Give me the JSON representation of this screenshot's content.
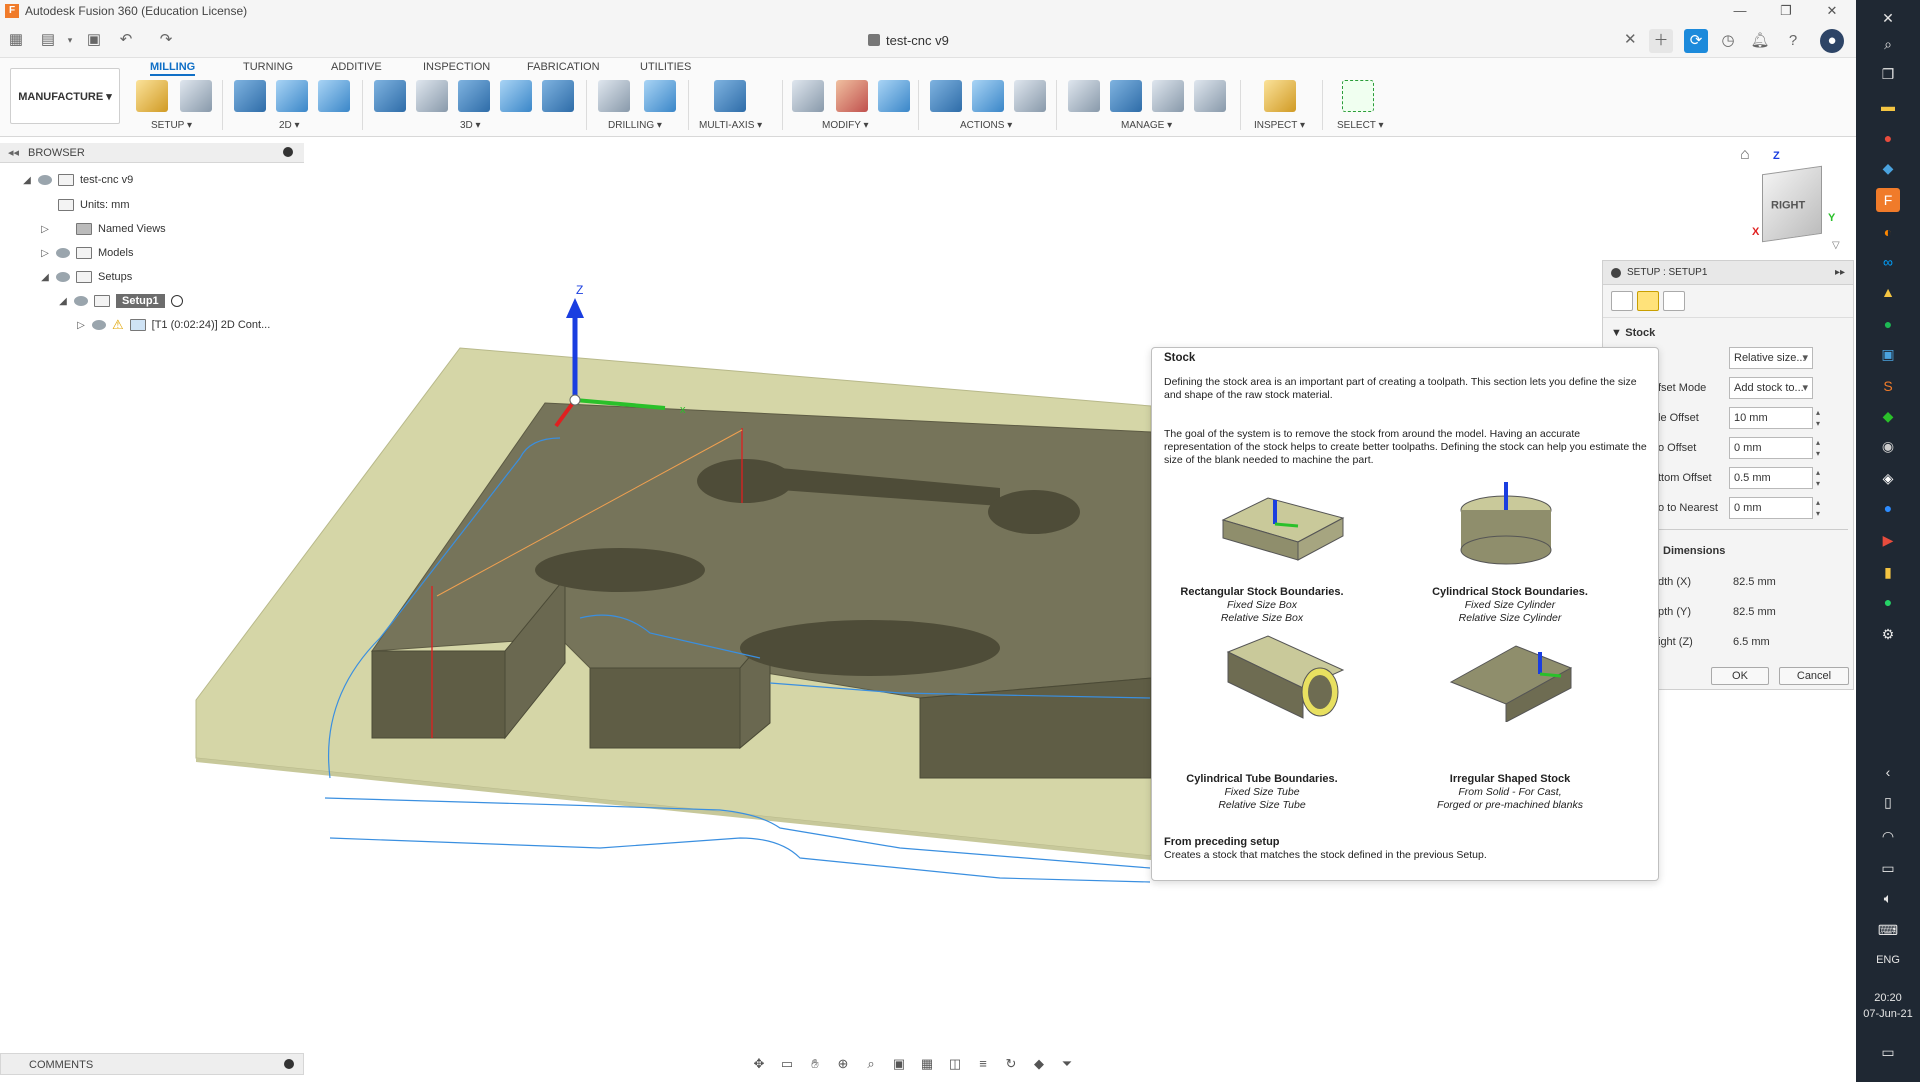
{
  "app": {
    "title": "Autodesk Fusion 360 (Education License)",
    "document_tab": "test-cnc v9",
    "accent": "#0f6fc6",
    "app_icon_letter": "F"
  },
  "ribbon": {
    "workspace": "MANUFACTURE",
    "tabs": [
      "MILLING",
      "TURNING",
      "ADDITIVE",
      "INSPECTION",
      "FABRICATION",
      "UTILITIES"
    ],
    "active_tab": "MILLING",
    "groups": [
      "SETUP ▾",
      "2D ▾",
      "3D ▾",
      "DRILLING ▾",
      "MULTI-AXIS ▾",
      "MODIFY ▾",
      "ACTIONS ▾",
      "MANAGE ▾",
      "INSPECT ▾",
      "SELECT ▾"
    ]
  },
  "browser": {
    "title": "BROWSER",
    "root": "test-cnc v9",
    "units": "Units: mm",
    "named_views": "Named Views",
    "models": "Models",
    "setups": "Setups",
    "setup1": "Setup1",
    "operation": "[T1 (0:02:24)] 2D Cont..."
  },
  "comments": {
    "title": "COMMENTS"
  },
  "viewcube": {
    "face": "RIGHT",
    "x_label": "X",
    "y_label": "Y",
    "z_label": "Z"
  },
  "viewport": {
    "axis_label_z": "Z",
    "axis_label_x": "x",
    "model_colors": {
      "stock": "#d7d8a8",
      "part": "#6e6c52",
      "toolpath": "#3a8fe0"
    }
  },
  "setup_panel": {
    "title": "SETUP : SETUP1",
    "section_stock": "Stock",
    "mode_value": "Relative size...",
    "offset_mode_label": "fset Mode",
    "offset_mode_value": "Add stock to...",
    "side_offset_label": "le Offset",
    "side_offset_value": "10 mm",
    "top_offset_label": "o Offset",
    "top_offset_value": "0 mm",
    "bottom_offset_label": "ttom Offset",
    "bottom_offset_value": "0.5 mm",
    "round_label": "o to Nearest",
    "round_value": "0 mm",
    "section_dimensions": "Dimensions",
    "width_label": "dth (X)",
    "width_value": "82.5 mm",
    "depth_label": "pth (Y)",
    "depth_value": "82.5 mm",
    "height_label": "ight (Z)",
    "height_value": "6.5 mm",
    "ok": "OK",
    "cancel": "Cancel"
  },
  "tooltip": {
    "title": "Stock",
    "para1": "Defining the stock area is an important part of creating a toolpath. This section lets you define the size and shape of the raw stock material.",
    "para2": "The goal of the system is to remove the stock from around the model. Having an accurate representation of the stock helps to create better toolpaths. Defining the stock can help you estimate the size of the blank needed to machine the part.",
    "options": [
      {
        "title": "Rectangular Stock Boundaries.",
        "line1": "Fixed Size Box",
        "line2": "Relative Size Box"
      },
      {
        "title": "Cylindrical Stock Boundaries.",
        "line1": "Fixed Size Cylinder",
        "line2": "Relative Size Cylinder"
      },
      {
        "title": "Cylindrical Tube Boundaries.",
        "line1": "Fixed Size Tube",
        "line2": "Relative Size Tube"
      },
      {
        "title": "Irregular Shaped Stock",
        "line1": "From Solid - For Cast,",
        "line2": "Forged or pre-machined blanks"
      }
    ],
    "preceding_title": "From preceding setup",
    "preceding_text": "Creates a stock that matches the stock defined in the previous Setup."
  },
  "taskbar": {
    "language": "ENG",
    "time": "20:20",
    "date": "07-Jun-21"
  }
}
